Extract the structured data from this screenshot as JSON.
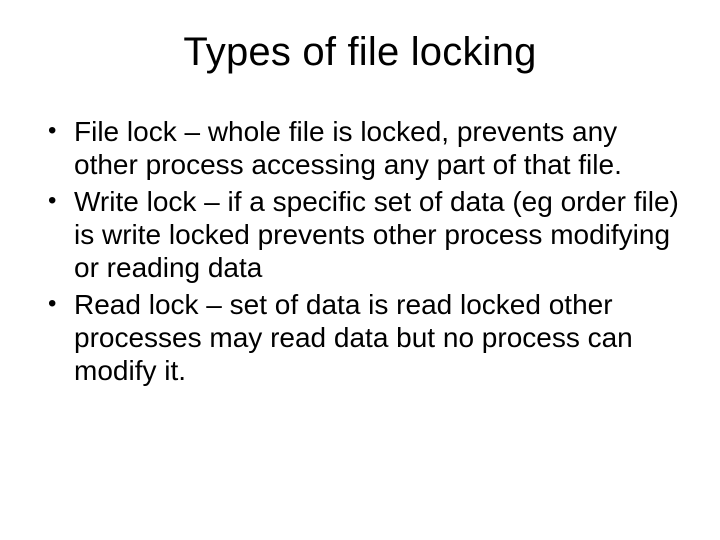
{
  "slide": {
    "title": "Types of file locking",
    "bullets": [
      "File lock – whole file is locked, prevents any other process accessing any part of that file.",
      "Write lock – if a specific set of data (eg order file) is write locked prevents other process modifying or reading data",
      "Read lock – set of data is read locked other processes may read data but no process can modify it."
    ]
  }
}
